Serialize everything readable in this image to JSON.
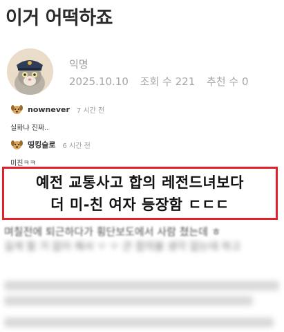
{
  "header": {
    "title": "이거 어떡하죠"
  },
  "post": {
    "author": "익명",
    "date": "2025.10.10",
    "views": "조회 수 221",
    "likes": "추천 수 0"
  },
  "comments": [
    {
      "user": "nownever",
      "time": "7 시간 전",
      "text": "실화냐 진짜.."
    },
    {
      "user": "띵킹슬로",
      "time": "6 시간 전",
      "text": "미친ㅋㅋ"
    }
  ],
  "banner": {
    "line1": "예전 교통사고 합의 레전드녀보다",
    "line2": "더 미-친 여자 등장함 ㄷㄷㄷ"
  },
  "body": {
    "line1": "며칠전에 퇴근하다가 횡단보도에서 사람 쳤는데 ㅎ",
    "line2": "길게 할 거 없이 해서 ㅜ ㅜ 큰 합의볼 생각 없는데 하고"
  }
}
